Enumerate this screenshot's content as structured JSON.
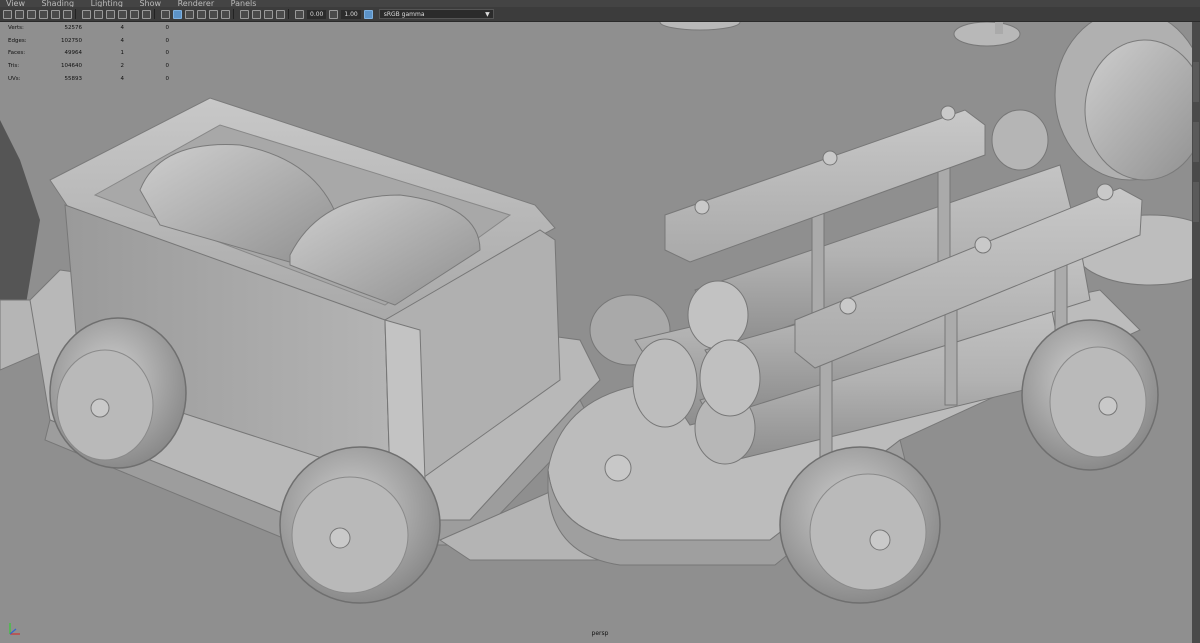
{
  "menu": [
    "View",
    "Shading",
    "Lighting",
    "Show",
    "Renderer",
    "Panels"
  ],
  "toolbar": {
    "exposure": "0.00",
    "gamma": "1.00",
    "color_space": "sRGB gamma"
  },
  "hud": {
    "rows": [
      {
        "label": "Verts:",
        "v1": "52576",
        "v2": "4",
        "v3": "0"
      },
      {
        "label": "Edges:",
        "v1": "102750",
        "v2": "4",
        "v3": "0"
      },
      {
        "label": "Faces:",
        "v1": "49964",
        "v2": "1",
        "v3": "0"
      },
      {
        "label": "Tris:",
        "v1": "104640",
        "v2": "2",
        "v3": "0"
      },
      {
        "label": "UVs:",
        "v1": "55893",
        "v2": "4",
        "v3": "0"
      }
    ]
  },
  "viewport": {
    "camera": "persp"
  }
}
